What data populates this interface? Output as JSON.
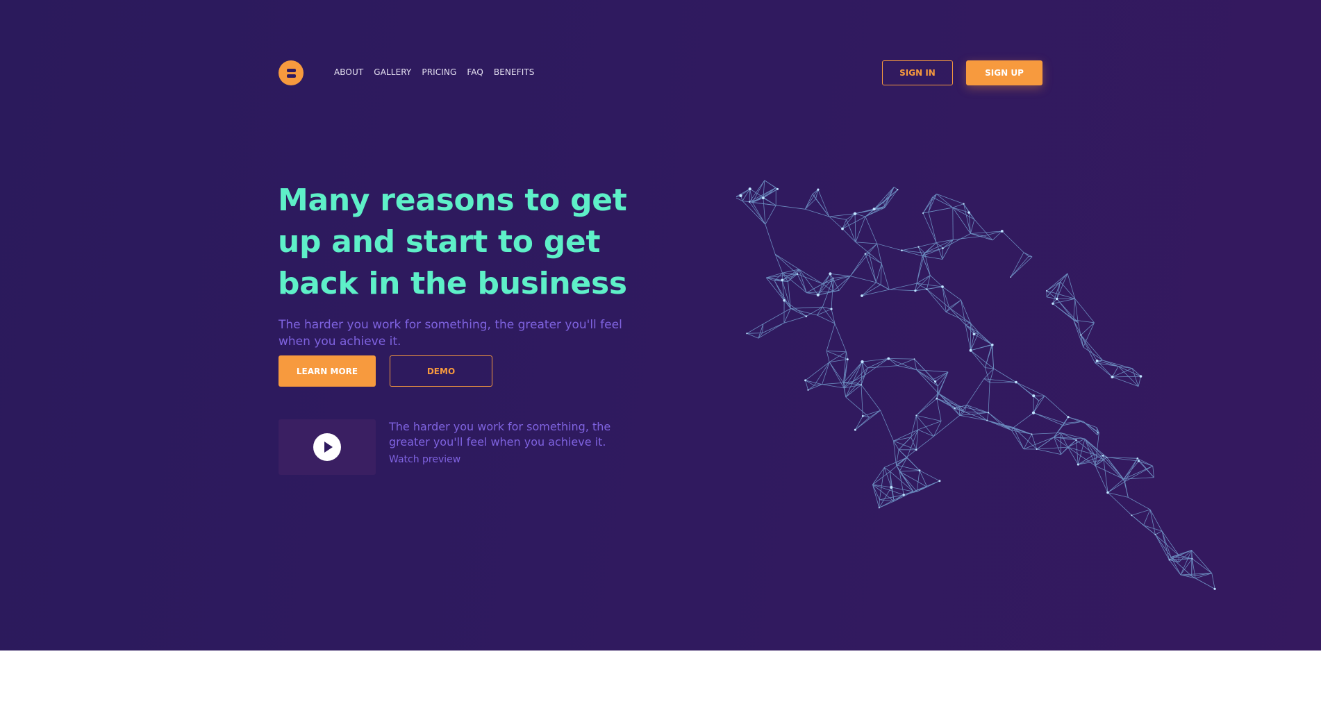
{
  "nav": {
    "items": [
      "ABOUT",
      "GALLERY",
      "PRICING",
      "FAQ",
      "BENEFITS"
    ]
  },
  "auth": {
    "sign_in": "SIGN IN",
    "sign_up": "SIGN UP"
  },
  "hero": {
    "headline": "Many reasons to get up and start to get back in the business",
    "subline": "The harder you work for something, the greater you'll feel when you achieve it.",
    "learn_more": "LEARN MORE",
    "demo": "DEMO"
  },
  "preview": {
    "text": "The harder you work for something, the greater you'll feel when you achieve it.",
    "link": "Watch preview"
  },
  "colors": {
    "background": "#2f1a5f",
    "accent": "#f79a3e",
    "headline": "#5ef0c8",
    "muted_text": "#7f63e0",
    "figure_lines": "#7fb3e0"
  },
  "icons": {
    "logo": "stacked-bars-logo-icon",
    "play": "play-icon",
    "figure": "low-poly-running-man-illustration"
  }
}
